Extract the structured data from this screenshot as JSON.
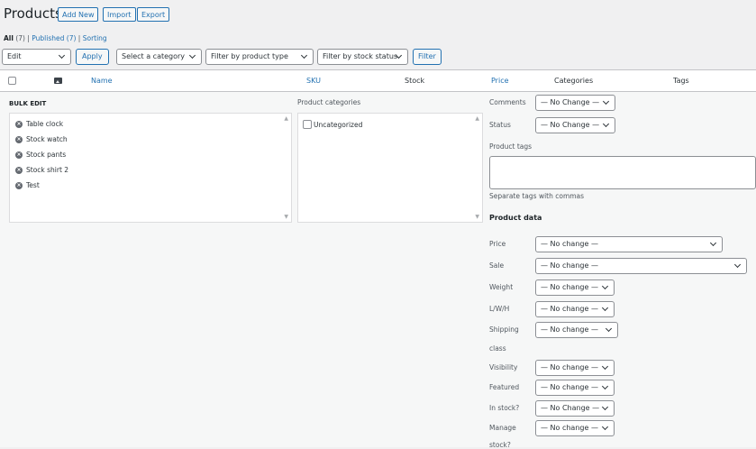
{
  "header": {
    "title": "Products",
    "add_new": "Add New",
    "import": "Import",
    "export": "Export"
  },
  "subsubsub": {
    "all": "All",
    "all_count": "(7)",
    "published": "Published (7)",
    "sorting": "Sorting",
    "sep": "|"
  },
  "filters": {
    "bulk_action": "Edit",
    "apply": "Apply",
    "category": "Select a category",
    "product_type": "Filter by product type",
    "stock_status": "Filter by stock status",
    "filter": "Filter"
  },
  "columns": {
    "name": "Name",
    "sku": "SKU",
    "stock": "Stock",
    "price": "Price",
    "categories": "Categories",
    "tags": "Tags"
  },
  "bulk_edit": {
    "heading": "BULK EDIT",
    "items": [
      "Table clock",
      "Stock watch",
      "Stock pants",
      "Stock shirt 2",
      "Test"
    ],
    "remove_glyph": "×",
    "categories_heading": "Product categories",
    "category_option": "Uncategorized",
    "comments_label": "Comments",
    "comments_value": "— No Change —",
    "status_label": "Status",
    "status_value": "— No Change —",
    "tags_label": "Product tags",
    "tags_hint": "Separate tags with commas",
    "product_data_heading": "Product data",
    "price_label": "Price",
    "price_value": "— No change —",
    "sale_label": "Sale",
    "sale_value": "— No change —",
    "weight_label": "Weight",
    "weight_value": "— No change —",
    "lwh_label": "L/W/H",
    "lwh_value": "— No change —",
    "shipping_label": "Shipping",
    "shipping_label2": "class",
    "shipping_value": "— No change —",
    "visibility_label": "Visibility",
    "visibility_value": "— No change —",
    "featured_label": "Featured",
    "featured_value": "— No change —",
    "instock_label": "In stock?",
    "instock_value": "— No Change —",
    "manage_label": "Manage",
    "manage_label2": "stock?",
    "manage_value": "— No change —"
  },
  "colors": {
    "accent": "#2271b1",
    "background": "#f0f0f1",
    "panel": "#f6f7f7"
  }
}
